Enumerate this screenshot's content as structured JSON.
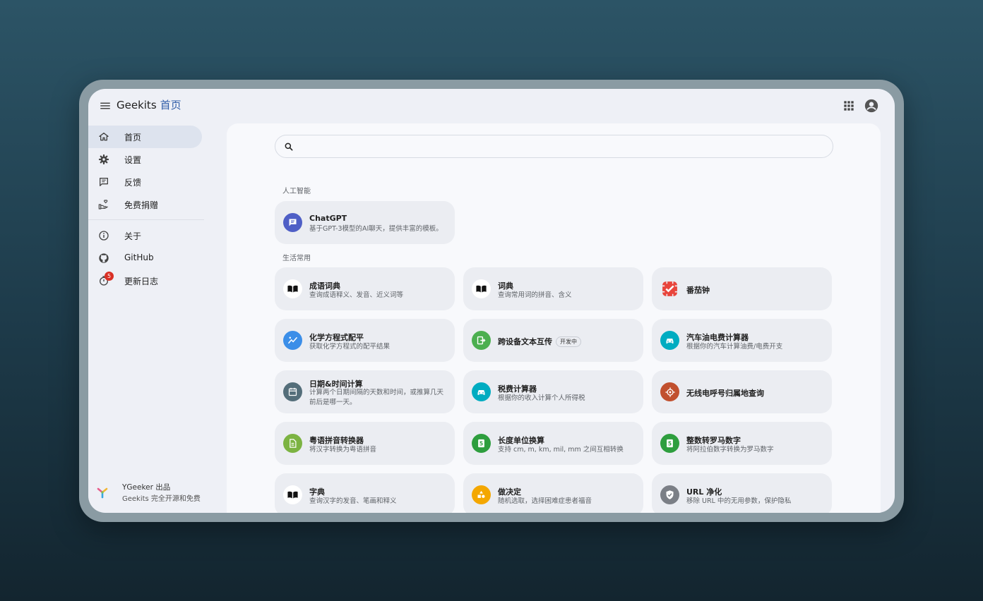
{
  "header": {
    "app_name": "Geekits",
    "page_title": "首页"
  },
  "sidebar": {
    "items": [
      {
        "label": "首页",
        "icon": "home-icon",
        "active": true
      },
      {
        "label": "设置",
        "icon": "gear-icon"
      },
      {
        "label": "反馈",
        "icon": "feedback-icon"
      },
      {
        "label": "免费捐赠",
        "icon": "donate-icon"
      }
    ],
    "items2": [
      {
        "label": "关于",
        "icon": "info-icon"
      },
      {
        "label": "GitHub",
        "icon": "github-icon"
      },
      {
        "label": "更新日志",
        "icon": "changelog-icon",
        "badge": "5"
      }
    ],
    "credit_line1": "YGeeker 出品",
    "credit_line2": "Geekits 完全开源和免费"
  },
  "search": {
    "value": "",
    "placeholder": ""
  },
  "sections": [
    {
      "title": "人工智能",
      "cards": [
        {
          "title": "ChatGPT",
          "desc": "基于GPT-3模型的AI聊天，提供丰富的模板。",
          "icon": "chat-icon",
          "color": "#4f5fc6"
        }
      ]
    },
    {
      "title": "生活常用",
      "cards": [
        {
          "title": "成语词典",
          "desc": "查询成语释义、发音、近义词等",
          "icon": "book-icon",
          "color": "#ffffff"
        },
        {
          "title": "词典",
          "desc": "查询常用词的拼音、含义",
          "icon": "book-icon",
          "color": "#ffffff"
        },
        {
          "title": "番茄钟",
          "desc": "",
          "icon": "tomato-icon",
          "color": "#e8453c"
        },
        {
          "title": "化学方程式配平",
          "desc": "获取化学方程式的配平结果",
          "icon": "chemistry-icon",
          "color": "#3b8ee8"
        },
        {
          "title": "跨设备文本互传",
          "tag": "开发中",
          "desc": "",
          "icon": "transfer-icon",
          "color": "#4caf50"
        },
        {
          "title": "汽车油电费计算器",
          "desc": "根据你的汽车计算油费/电费开支",
          "icon": "car-icon",
          "color": "#00acc1"
        },
        {
          "title": "日期&时间计算",
          "desc": "计算两个日期间隔的天数和时间，或推算几天前后是哪一天。",
          "icon": "calendar-icon",
          "color": "#546e7a"
        },
        {
          "title": "税费计算器",
          "desc": "根据你的收入计算个人所得税",
          "icon": "tax-icon",
          "color": "#00acc1"
        },
        {
          "title": "无线电呼号归属地查询",
          "desc": "",
          "icon": "radio-icon",
          "color": "#c1502e"
        },
        {
          "title": "粤语拼音转换器",
          "desc": "将汉字转换为粤语拼音",
          "icon": "document-icon",
          "color": "#7cb342"
        },
        {
          "title": "长度单位换算",
          "desc": "支持 cm, m, km, mil, mm 之间互相转换",
          "icon": "ruler-icon",
          "color": "#2e9e3e"
        },
        {
          "title": "整数转罗马数字",
          "desc": "将阿拉伯数字转换为罗马数字",
          "icon": "roman-icon",
          "color": "#2e9e3e"
        },
        {
          "title": "字典",
          "desc": "查询汉字的发音、笔画和释义",
          "icon": "book-icon",
          "color": "#ffffff"
        },
        {
          "title": "做决定",
          "desc": "随机选取，选择困难症患者福音",
          "icon": "shapes-icon",
          "color": "#f4a700"
        },
        {
          "title": "URL 净化",
          "desc": "移除 URL 中的无用参数，保护隐私",
          "icon": "shield-icon",
          "color": "#7b7f86"
        }
      ]
    }
  ]
}
